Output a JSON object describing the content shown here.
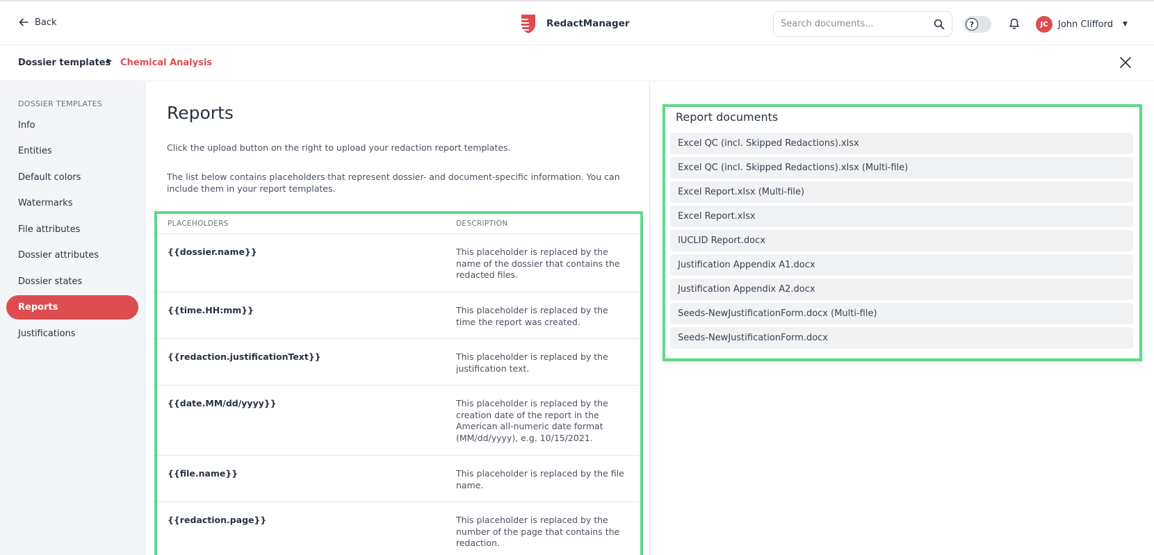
{
  "header": {
    "back_label": "Back",
    "app_name": "RedactManager",
    "search_placeholder": "Search documents...",
    "help_glyph": "?",
    "user": {
      "initials": "JC",
      "name": "John Clifford"
    }
  },
  "breadcrumb": {
    "parent": "Dossier templates",
    "current": "Chemical Analysis"
  },
  "sidebar": {
    "title": "DOSSIER TEMPLATES",
    "items": [
      {
        "label": "Info",
        "active": false
      },
      {
        "label": "Entities",
        "active": false
      },
      {
        "label": "Default colors",
        "active": false
      },
      {
        "label": "Watermarks",
        "active": false
      },
      {
        "label": "File attributes",
        "active": false
      },
      {
        "label": "Dossier attributes",
        "active": false
      },
      {
        "label": "Dossier states",
        "active": false
      },
      {
        "label": "Reports",
        "active": true
      },
      {
        "label": "Justifications",
        "active": false
      }
    ]
  },
  "main": {
    "title": "Reports",
    "description_1": "Click the upload button on the right to upload your redaction report templates.",
    "description_2": "The list below contains placeholders that represent dossier- and document-specific information. You can include them in your report templates.",
    "table": {
      "col_placeholders": "PLACEHOLDERS",
      "col_description": "DESCRIPTION",
      "rows": [
        {
          "placeholder": "{{dossier.name}}",
          "description": "This placeholder is replaced by the name of the dossier that contains the redacted files."
        },
        {
          "placeholder": "{{time.HH:mm}}",
          "description": "This placeholder is replaced by the time the report was created."
        },
        {
          "placeholder": "{{redaction.justificationText}}",
          "description": "This placeholder is replaced by the justification text."
        },
        {
          "placeholder": "{{date.MM/dd/yyyy}}",
          "description": "This placeholder is replaced by the creation date of the report in the American all-numeric date format (MM/dd/yyyy), e.g. 10/15/2021."
        },
        {
          "placeholder": "{{file.name}}",
          "description": "This placeholder is replaced by the file name."
        },
        {
          "placeholder": "{{redaction.page}}",
          "description": "This placeholder is replaced by the number of the page that contains the redaction."
        }
      ]
    }
  },
  "report_documents": {
    "title": "Report documents",
    "items": [
      "Excel QC (incl. Skipped Redactions).xlsx",
      "Excel QC (incl. Skipped Redactions).xlsx (Multi-file)",
      "Excel Report.xlsx (Multi-file)",
      "Excel Report.xlsx",
      "IUCLID Report.docx",
      "Justification Appendix A1.docx",
      "Justification Appendix A2.docx",
      "Seeds-NewJustificationForm.docx (Multi-file)",
      "Seeds-NewJustificationForm.docx"
    ]
  },
  "colors": {
    "accent": "#dd4d50",
    "highlight_border": "#5fd98a",
    "sidebar_bg": "#f4f5f7",
    "text": "#283241"
  }
}
